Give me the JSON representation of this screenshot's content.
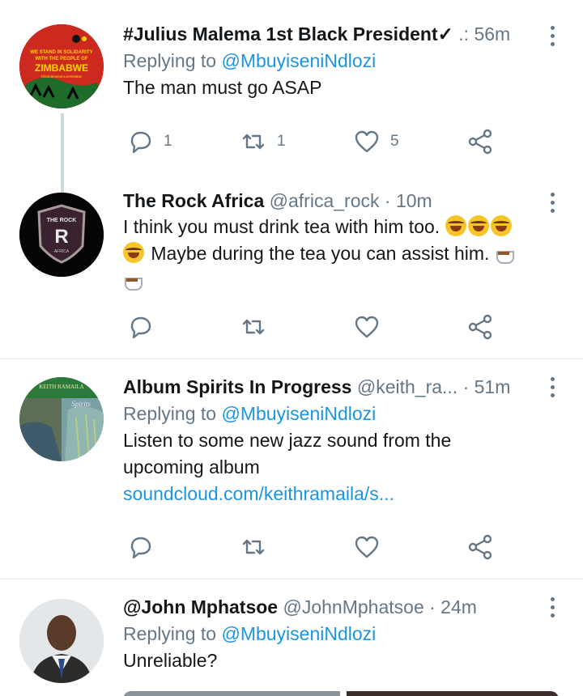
{
  "tweets": [
    {
      "name": "#Julius Malema 1st Black President✓",
      "handle": " .:",
      "time": "56m",
      "replying_prefix": "Replying to ",
      "replying_to": "@MbuyiseniNdlozi",
      "text": "The man must go ASAP",
      "actions": {
        "replies": "1",
        "retweets": "1",
        "likes": "5"
      },
      "avatar_text": [
        "WE STAND IN SOLIDARITY",
        "WITH THE PEOPLE OF",
        "ZIMBABWE",
        "#ZimbabweanLivesMatter"
      ]
    },
    {
      "name": "The Rock Africa",
      "handle": "@africa_rock",
      "time": "· 10m",
      "text_line1": "I think you must drink tea with him too.",
      "text_line2": "Maybe during the tea you can assist him.",
      "actions": {
        "replies": "",
        "retweets": "",
        "likes": ""
      },
      "avatar_text": [
        "THE ROCK",
        "R",
        "AFRICA"
      ]
    },
    {
      "name": "Album Spirits In Progress",
      "handle": "@keith_ra...",
      "time": "· 51m",
      "replying_prefix": "Replying to ",
      "replying_to": "@MbuyiseniNdlozi",
      "text_line1": "Listen to some new jazz sound from the",
      "text_line2": "upcoming album",
      "link": "soundcloud.com/keithramaila/s...",
      "actions": {
        "replies": "",
        "retweets": "",
        "likes": ""
      },
      "avatar_text": [
        "KEITH RAMAILA",
        "Spirits"
      ]
    },
    {
      "name": "@John Mphatsoe",
      "handle": "@JohnMphatsoe",
      "time": "· 24m",
      "replying_prefix": "Replying to ",
      "replying_to": "@MbuyiseniNdlozi",
      "text": "Unreliable?"
    }
  ],
  "colors": {
    "text": "#14171a",
    "muted": "#657786",
    "link": "#1b95e0",
    "divider": "#e1e8ed"
  },
  "icons": {
    "reply": "reply-icon",
    "retweet": "retweet-icon",
    "like": "heart-icon",
    "share": "share-icon",
    "more": "more-vertical-icon"
  }
}
